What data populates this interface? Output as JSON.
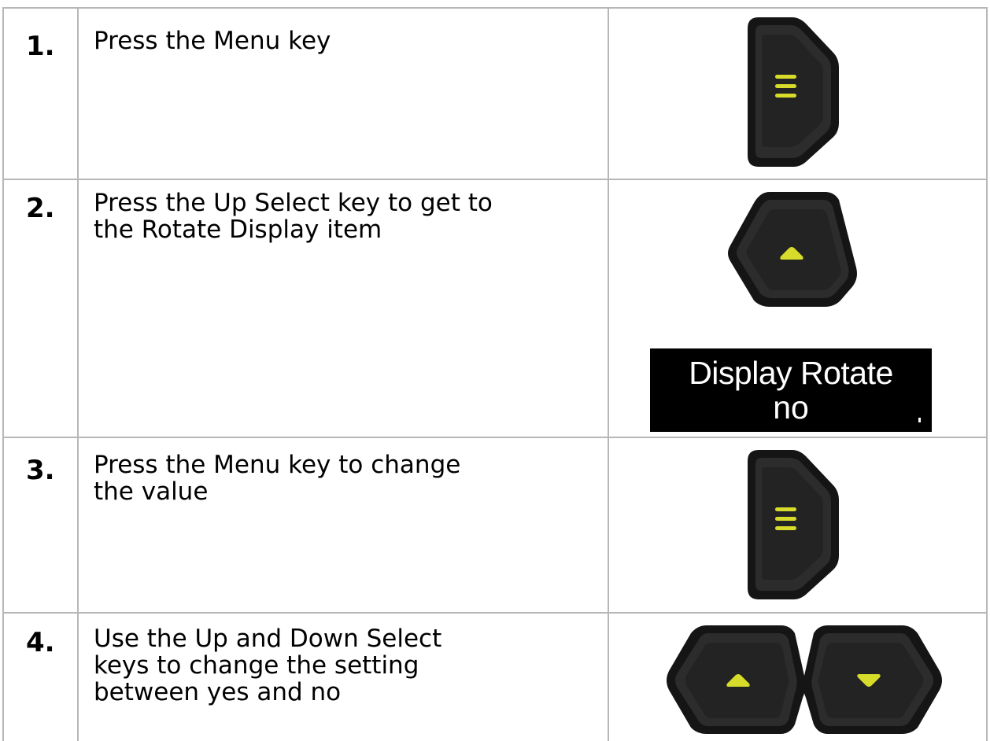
{
  "steps": [
    {
      "number": "1.",
      "text": "Press the Menu key",
      "key": "menu-key"
    },
    {
      "number": "2.",
      "text": "Press the Up Select key to get to\nthe Rotate Display item",
      "key": "up-select-key"
    },
    {
      "number": "3.",
      "text": "Press the Menu key to change\nthe value",
      "key": "menu-key"
    },
    {
      "number": "4.",
      "text": "Use the Up and Down Select\nkeys to change the setting\nbetween yes and no",
      "key": "up-and-down-select-keys"
    }
  ],
  "display": {
    "line1": "Display Rotate",
    "line2": "no"
  },
  "icons": {
    "menu": "menu-key-icon",
    "up": "up-select-key-icon",
    "down": "down-select-key-icon"
  },
  "colors": {
    "key_body": "#1f1f1f",
    "key_face": "#2c2c2c",
    "key_symbol": "#d7dc2a",
    "border": "#b7b7b7",
    "display_bg": "#000000",
    "display_text": "#ffffff"
  }
}
